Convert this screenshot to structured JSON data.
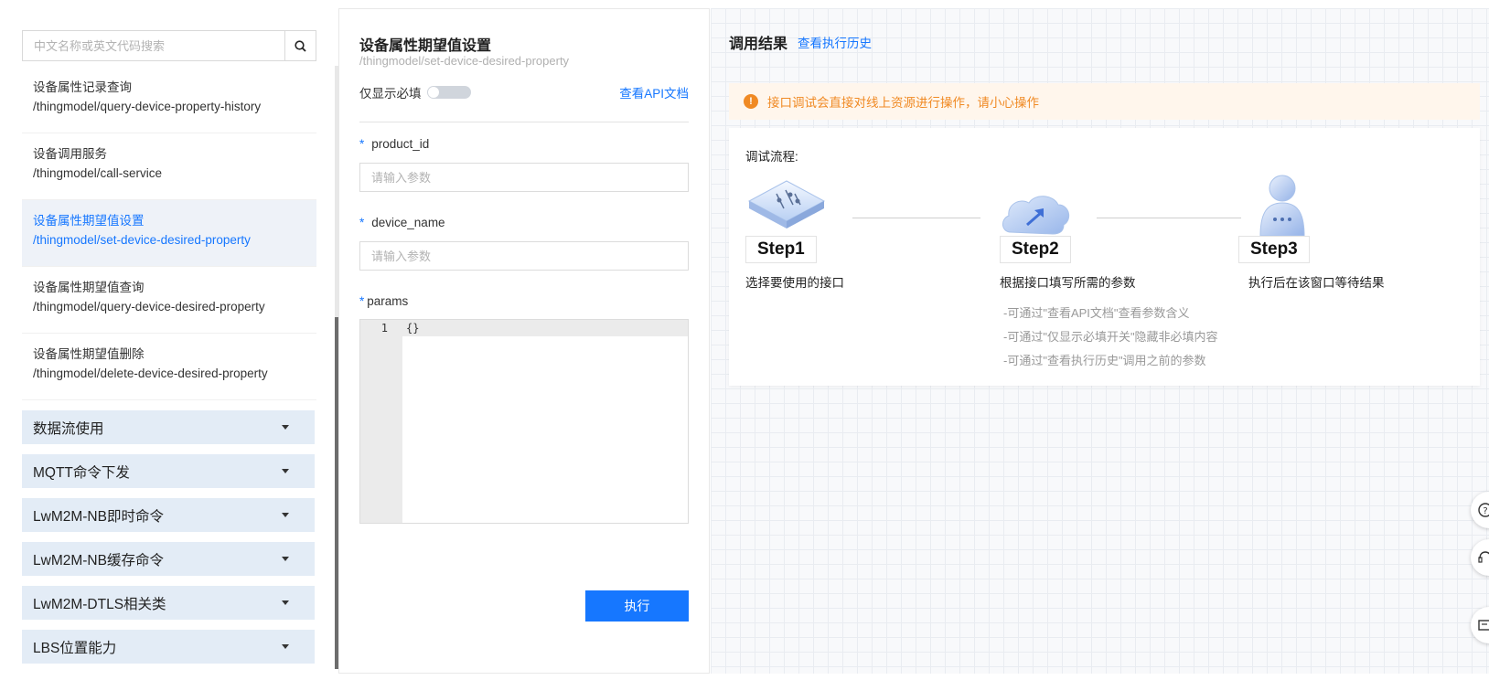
{
  "search": {
    "placeholder": "中文名称或英文代码搜索"
  },
  "api_list": [
    {
      "name": "设备属性记录查询",
      "path": "/thingmodel/query-device-property-history",
      "active": false
    },
    {
      "name": "设备调用服务",
      "path": "/thingmodel/call-service",
      "active": false
    },
    {
      "name": "设备属性期望值设置",
      "path": "/thingmodel/set-device-desired-property",
      "active": true
    },
    {
      "name": "设备属性期望值查询",
      "path": "/thingmodel/query-device-desired-property",
      "active": false
    },
    {
      "name": "设备属性期望值删除",
      "path": "/thingmodel/delete-device-desired-property",
      "active": false
    }
  ],
  "groups": [
    "数据流使用",
    "MQTT命令下发",
    "LwM2M-NB即时命令",
    "LwM2M-NB缓存命令",
    "LwM2M-DTLS相关类",
    "LBS位置能力"
  ],
  "form": {
    "title": "设备属性期望值设置",
    "path": "/thingmodel/set-device-desired-property",
    "toggle_label": "仅显示必填",
    "api_doc_link": "查看API文档",
    "fields": [
      {
        "label": "product_id",
        "placeholder": "请输入参数",
        "required_mark": "*"
      },
      {
        "label": "device_name",
        "placeholder": "请输入参数",
        "required_mark": "*"
      }
    ],
    "params_label": "params",
    "params_required_mark": "*",
    "code_line_number": "1",
    "code_value": "{}",
    "execute_label": "执行"
  },
  "result": {
    "title": "调用结果",
    "history_link": "查看执行历史",
    "warning": "接口调试会直接对线上资源进行操作，请小心操作",
    "flow_title": "调试流程:",
    "steps": [
      {
        "label": "Step1",
        "desc": "选择要使用的接口"
      },
      {
        "label": "Step2",
        "desc": "根据接口填写所需的参数"
      },
      {
        "label": "Step3",
        "desc": "执行后在该窗口等待结果"
      }
    ],
    "hints": [
      "-可通过\"查看API文档\"查看参数含义",
      "-可通过\"仅显示必填开关\"隐藏非必填内容",
      "-可通过\"查看执行历史\"调用之前的参数"
    ]
  },
  "colors": {
    "accent": "#1677ff",
    "warning": "#f08a24",
    "group_bg": "#e3ecf6",
    "active_bg": "#eef2f8"
  },
  "icons": [
    "search-icon",
    "warning-icon",
    "settings-sliders-icon",
    "cloud-upload-icon",
    "user-icon",
    "help-icon",
    "support-icon",
    "feedback-icon"
  ]
}
